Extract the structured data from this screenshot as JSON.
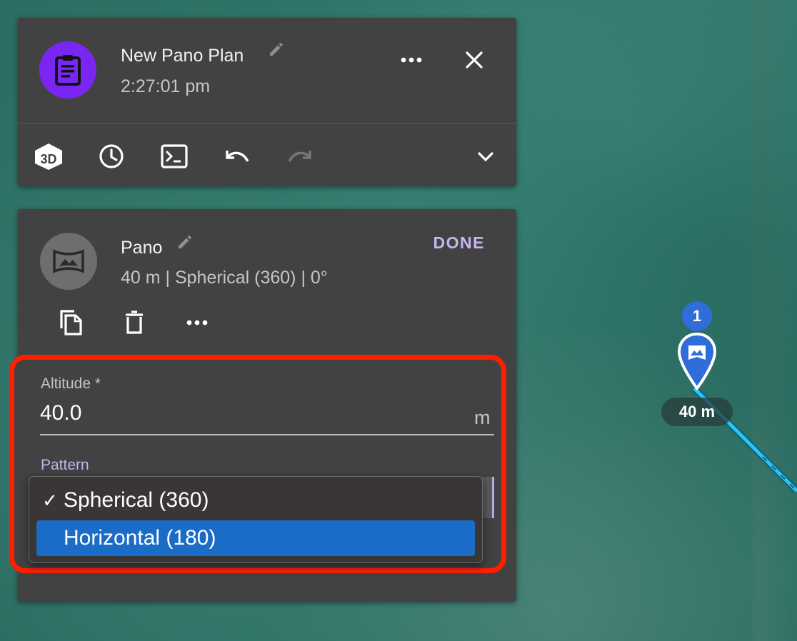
{
  "plan": {
    "title": "New Pano Plan",
    "time": "2:27:01 pm",
    "avatar_icon": "clipboard-icon",
    "accent": "#7a26f3",
    "toolbar": [
      {
        "name": "3d-view-icon"
      },
      {
        "name": "history-icon"
      },
      {
        "name": "terminal-icon"
      },
      {
        "name": "undo-icon"
      },
      {
        "name": "redo-icon",
        "disabled": true
      },
      {
        "name": "chevron-down-icon"
      }
    ]
  },
  "action": {
    "title": "Pano",
    "summary": "40 m | Spherical (360) | 0°",
    "done_label": "DONE",
    "avatar_icon": "panorama-icon"
  },
  "altitude": {
    "label": "Altitude *",
    "value": "40.0",
    "unit": "m"
  },
  "pattern": {
    "label": "Pattern",
    "options": [
      {
        "label": "Spherical (360)",
        "checked": true,
        "mark": "✓"
      },
      {
        "label": "Horizontal (180)",
        "highlighted": true
      }
    ]
  },
  "map": {
    "waypoint_number": "1",
    "altitude_badge": "40 m",
    "marker_color": "#2f6ed8",
    "route_color": "#2ec4f0"
  },
  "colors": {
    "highlight_border": "#ff1e00",
    "selected_option": "#1b6cc7",
    "done": "#c7b5f0"
  }
}
